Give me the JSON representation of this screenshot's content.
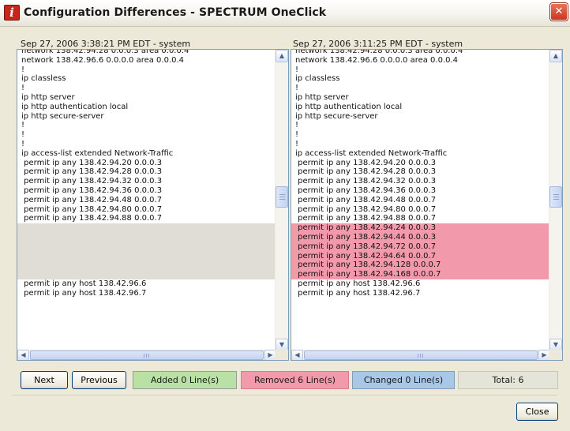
{
  "window": {
    "title": "Configuration Differences - SPECTRUM OneClick",
    "icon_letter": "i",
    "close_glyph": "✕"
  },
  "panes": {
    "left": {
      "header": "Sep 27, 2006 3:38:21 PM EDT - system",
      "lines": [
        {
          "text": "network 138.42.94.28 0.0.0.3 area 0.0.0.4",
          "type": "normal"
        },
        {
          "text": "network 138.42.96.6 0.0.0.0 area 0.0.0.4",
          "type": "normal"
        },
        {
          "text": "!",
          "type": "normal"
        },
        {
          "text": "ip classless",
          "type": "normal"
        },
        {
          "text": "!",
          "type": "normal"
        },
        {
          "text": "ip http server",
          "type": "normal"
        },
        {
          "text": "ip http authentication local",
          "type": "normal"
        },
        {
          "text": "ip http secure-server",
          "type": "normal"
        },
        {
          "text": "!",
          "type": "normal"
        },
        {
          "text": "!",
          "type": "normal"
        },
        {
          "text": "!",
          "type": "normal"
        },
        {
          "text": "ip access-list extended Network-Traffic",
          "type": "normal"
        },
        {
          "text": " permit ip any 138.42.94.20 0.0.0.3",
          "type": "normal"
        },
        {
          "text": " permit ip any 138.42.94.28 0.0.0.3",
          "type": "normal"
        },
        {
          "text": " permit ip any 138.42.94.32 0.0.0.3",
          "type": "normal"
        },
        {
          "text": " permit ip any 138.42.94.36 0.0.0.3",
          "type": "normal"
        },
        {
          "text": " permit ip any 138.42.94.48 0.0.0.7",
          "type": "normal"
        },
        {
          "text": " permit ip any 138.42.94.80 0.0.0.7",
          "type": "normal"
        },
        {
          "text": " permit ip any 138.42.94.88 0.0.0.7",
          "type": "normal"
        },
        {
          "text": "",
          "type": "filler"
        },
        {
          "text": "",
          "type": "filler"
        },
        {
          "text": "",
          "type": "filler"
        },
        {
          "text": "",
          "type": "filler"
        },
        {
          "text": "",
          "type": "filler"
        },
        {
          "text": "",
          "type": "filler"
        },
        {
          "text": " permit ip any host 138.42.96.6",
          "type": "normal"
        },
        {
          "text": " permit ip any host 138.42.96.7",
          "type": "normal"
        }
      ]
    },
    "right": {
      "header": "Sep 27, 2006 3:11:25 PM EDT - system",
      "lines": [
        {
          "text": "network 138.42.94.28 0.0.0.3 area 0.0.0.4",
          "type": "normal"
        },
        {
          "text": "network 138.42.96.6 0.0.0.0 area 0.0.0.4",
          "type": "normal"
        },
        {
          "text": "!",
          "type": "normal"
        },
        {
          "text": "ip classless",
          "type": "normal"
        },
        {
          "text": "!",
          "type": "normal"
        },
        {
          "text": "ip http server",
          "type": "normal"
        },
        {
          "text": "ip http authentication local",
          "type": "normal"
        },
        {
          "text": "ip http secure-server",
          "type": "normal"
        },
        {
          "text": "!",
          "type": "normal"
        },
        {
          "text": "!",
          "type": "normal"
        },
        {
          "text": "!",
          "type": "normal"
        },
        {
          "text": "ip access-list extended Network-Traffic",
          "type": "normal"
        },
        {
          "text": " permit ip any 138.42.94.20 0.0.0.3",
          "type": "normal"
        },
        {
          "text": " permit ip any 138.42.94.28 0.0.0.3",
          "type": "normal"
        },
        {
          "text": " permit ip any 138.42.94.32 0.0.0.3",
          "type": "normal"
        },
        {
          "text": " permit ip any 138.42.94.36 0.0.0.3",
          "type": "normal"
        },
        {
          "text": " permit ip any 138.42.94.48 0.0.0.7",
          "type": "normal"
        },
        {
          "text": " permit ip any 138.42.94.80 0.0.0.7",
          "type": "normal"
        },
        {
          "text": " permit ip any 138.42.94.88 0.0.0.7",
          "type": "normal"
        },
        {
          "text": " permit ip any 138.42.94.24 0.0.0.3",
          "type": "removed"
        },
        {
          "text": " permit ip any 138.42.94.44 0.0.0.3",
          "type": "removed"
        },
        {
          "text": " permit ip any 138.42.94.72 0.0.0.7",
          "type": "removed"
        },
        {
          "text": " permit ip any 138.42.94.64 0.0.0.7",
          "type": "removed"
        },
        {
          "text": " permit ip any 138.42.94.128 0.0.0.7",
          "type": "removed"
        },
        {
          "text": " permit ip any 138.42.94.168 0.0.0.7",
          "type": "removed"
        },
        {
          "text": " permit ip any host 138.42.96.6",
          "type": "normal"
        },
        {
          "text": " permit ip any host 138.42.96.7",
          "type": "normal"
        }
      ]
    }
  },
  "scrollbar": {
    "up_glyph": "▲",
    "down_glyph": "▼",
    "left_glyph": "◀",
    "right_glyph": "▶"
  },
  "buttons": {
    "next": "Next",
    "previous": "Previous",
    "close": "Close"
  },
  "legend": {
    "added": "Added 0 Line(s)",
    "removed": "Removed 6 Line(s)",
    "changed": "Changed 0 Line(s)",
    "total": "Total: 6"
  },
  "colors": {
    "removed": "#f29aab",
    "added": "#b9e0a5",
    "changed": "#a9c8e8",
    "filler": "#e0ddd6"
  }
}
